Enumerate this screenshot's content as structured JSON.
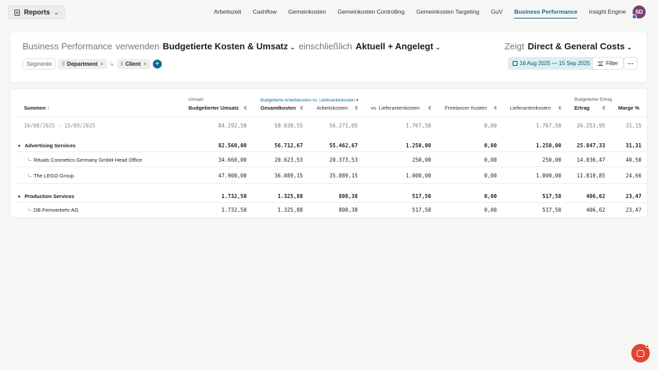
{
  "topnav": {
    "reports_label": "Reports",
    "links": [
      "Arbeitszeit",
      "Cashflow",
      "Gemeinkosten",
      "Gemeinkosten Controlling",
      "Gemeinkosten Targeting",
      "GuV",
      "Business Performance",
      "Insight Engine"
    ],
    "active": "Business Performance",
    "avatar_initials": "SD"
  },
  "header": {
    "w1": "Business Performance",
    "w2": "verwenden",
    "w3": "Budgetierte Kosten & Umsatz",
    "w4": "einschließlich",
    "w5": "Aktuell + Angelegt",
    "show_label": "Zeigt",
    "show_value": "Direct & General Costs",
    "segments_label": "Segmente",
    "chip1": "Department",
    "chip2": "Client",
    "date_range": "16 Aug 2025 — 15 Sep 2025",
    "filter_label": "Filter",
    "more_label": "···"
  },
  "table": {
    "group_umsatz": "Umsatz",
    "group_kosten": "Budgetierte Arbeitskosten vs. Lieferantenkosten ▾",
    "group_ertrag": "Budgetierter Ertrag",
    "col_summen": "Summen",
    "col_umsatz": "Budgetierter Umsatz",
    "col_gesamt": "Gesamtkosten",
    "col_arbeit": "Arbeitskosten",
    "col_vslief": "vs. Lieferantenkosten",
    "col_freel": "Freelancer Kosten",
    "col_lief": "Lieferantenkosten",
    "col_ertrag": "Ertrag",
    "col_marge": "Marge %",
    "currency": "€",
    "rows": [
      {
        "label": "16/08/2025 - 15/09/2025",
        "v": [
          "84.292,50",
          "58.038,55",
          "56.271,05",
          "1.767,50",
          "0,00",
          "1.767,50",
          "26.253,95",
          "31,15"
        ]
      },
      {
        "label": "Advertising Services",
        "v": [
          "82.560,00",
          "56.712,67",
          "55.462,67",
          "1.250,00",
          "0,00",
          "1.250,00",
          "25.847,33",
          "31,31"
        ]
      },
      {
        "label": "Rituals Cosmetics Germany GmbH Head Office",
        "v": [
          "34.660,00",
          "20.623,53",
          "20.373,53",
          "250,00",
          "0,00",
          "250,00",
          "14.036,47",
          "40,50"
        ]
      },
      {
        "label": "The LEGO Group",
        "v": [
          "47.900,00",
          "36.089,15",
          "35.089,15",
          "1.000,00",
          "0,00",
          "1.000,00",
          "11.810,85",
          "24,66"
        ]
      },
      {
        "label": "Production Services",
        "v": [
          "1.732,50",
          "1.325,88",
          "808,38",
          "517,50",
          "0,00",
          "517,50",
          "406,62",
          "23,47"
        ]
      },
      {
        "label": "DB Fernverkehr AG",
        "v": [
          "1.732,50",
          "1.325,88",
          "808,38",
          "517,50",
          "0,00",
          "517,50",
          "406,62",
          "23,47"
        ]
      }
    ]
  }
}
